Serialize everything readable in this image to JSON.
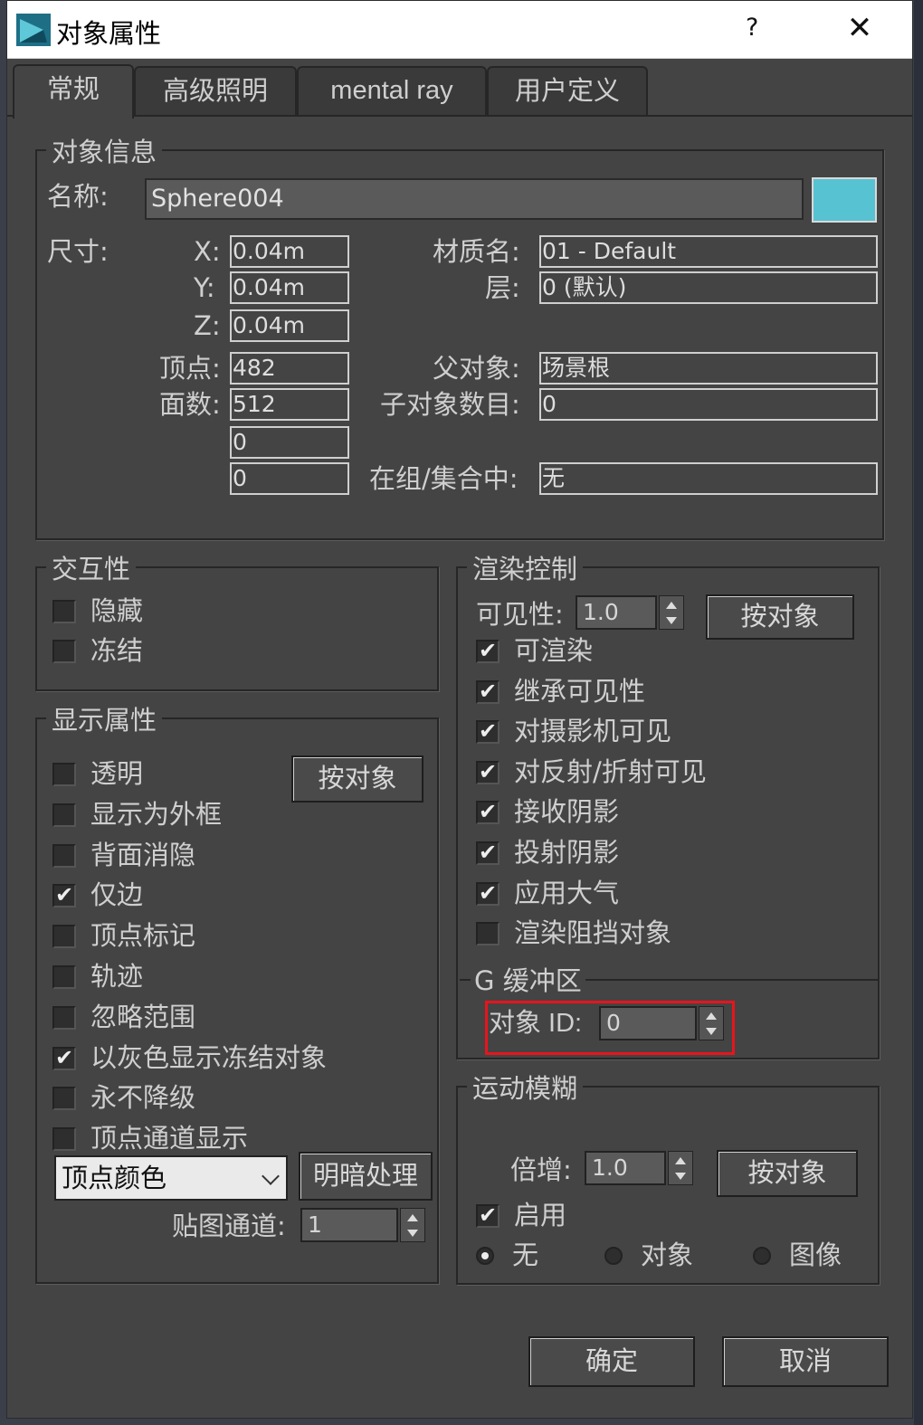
{
  "window": {
    "title": "对象属性",
    "help": "?",
    "close": "✕"
  },
  "tabs": [
    "常规",
    "高级照明",
    "mental ray",
    "用户定义"
  ],
  "info": {
    "legend": "对象信息",
    "name_label": "名称:",
    "name_value": "Sphere004",
    "color": "#56c2d2",
    "size_label": "尺寸:",
    "x_label": "X:",
    "x_value": "0.04m",
    "y_label": "Y:",
    "y_value": "0.04m",
    "z_label": "Z:",
    "z_value": "0.04m",
    "vertices_label": "顶点:",
    "vertices_value": "482",
    "faces_label": "面数:",
    "faces_value": "512",
    "extra1_value": "0",
    "extra2_value": "0",
    "material_label": "材质名:",
    "material_value": "01 - Default",
    "layer_label": "层:",
    "layer_value": "0 (默认)",
    "parent_label": "父对象:",
    "parent_value": "场景根",
    "children_label": "子对象数目:",
    "children_value": "0",
    "group_label": "在组/集合中:",
    "group_value": "无"
  },
  "interactivity": {
    "legend": "交互性",
    "items": [
      {
        "label": "隐藏",
        "checked": false
      },
      {
        "label": "冻结",
        "checked": false
      }
    ]
  },
  "display": {
    "legend": "显示属性",
    "by_object": "按对象",
    "items": [
      {
        "label": "透明",
        "checked": false
      },
      {
        "label": "显示为外框",
        "checked": false
      },
      {
        "label": "背面消隐",
        "checked": false
      },
      {
        "label": "仅边",
        "checked": true
      },
      {
        "label": "顶点标记",
        "checked": false
      },
      {
        "label": "轨迹",
        "checked": false
      },
      {
        "label": "忽略范围",
        "checked": false
      },
      {
        "label": "以灰色显示冻结对象",
        "checked": true
      },
      {
        "label": "永不降级",
        "checked": false
      },
      {
        "label": "顶点通道显示",
        "checked": false
      }
    ],
    "dropdown_value": "顶点颜色",
    "shade_button": "明暗处理",
    "map_channel_label": "贴图通道:",
    "map_channel_value": "1"
  },
  "render": {
    "legend": "渲染控制",
    "visibility_label": "可见性:",
    "visibility_value": "1.0",
    "by_object": "按对象",
    "items": [
      {
        "label": "可渲染",
        "checked": true
      },
      {
        "label": "继承可见性",
        "checked": true
      },
      {
        "label": "对摄影机可见",
        "checked": true
      },
      {
        "label": "对反射/折射可见",
        "checked": true
      },
      {
        "label": "接收阴影",
        "checked": true
      },
      {
        "label": "投射阴影",
        "checked": true
      },
      {
        "label": "应用大气",
        "checked": true
      },
      {
        "label": "渲染阻挡对象",
        "checked": false
      }
    ],
    "gbuffer_legend": "G 缓冲区",
    "object_id_label": "对象 ID:",
    "object_id_value": "0"
  },
  "motion_blur": {
    "legend": "运动模糊",
    "multiplier_label": "倍增:",
    "multiplier_value": "1.0",
    "by_object": "按对象",
    "enable_label": "启用",
    "enable_checked": true,
    "radios": [
      {
        "label": "无",
        "selected": true
      },
      {
        "label": "对象",
        "selected": false
      },
      {
        "label": "图像",
        "selected": false
      }
    ]
  },
  "footer": {
    "ok": "确定",
    "cancel": "取消"
  },
  "highlight_color": "#e8141c"
}
